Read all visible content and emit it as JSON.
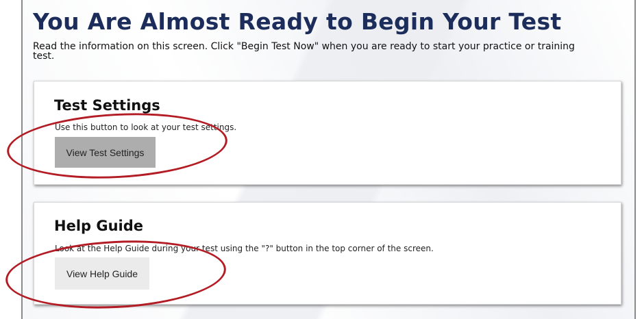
{
  "header": {
    "title": "You Are Almost Ready to Begin Your Test",
    "intro": "Read the information on this screen. Click \"Begin Test Now\" when you are ready to start your practice or training test."
  },
  "cards": {
    "settings": {
      "heading": "Test Settings",
      "description": "Use this button to look at your test settings.",
      "button_label": "View Test Settings"
    },
    "help": {
      "heading": "Help Guide",
      "description": "Look at the Help Guide during your test using the \"?\" button in the top corner of the screen.",
      "button_label": "View Help Guide"
    }
  },
  "colors": {
    "title": "#1c2d5b",
    "annotation_circle": "#b31c24",
    "settings_button": "#adadad",
    "help_button": "#ebebeb"
  }
}
